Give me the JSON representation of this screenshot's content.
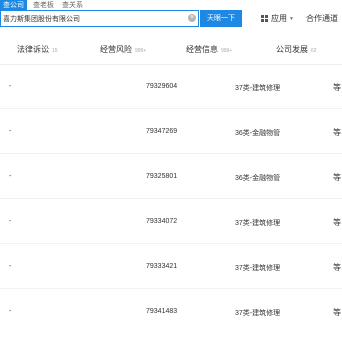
{
  "search_tabs": [
    "查公司",
    "查老板",
    "查关系"
  ],
  "search": {
    "value": "喜力斯集团股份有限公司",
    "button_label": "天眼一下"
  },
  "menus": {
    "apps_label": "应用",
    "coop_label": "合作通道"
  },
  "columns": [
    {
      "label": "法律诉讼",
      "count": "15"
    },
    {
      "label": "经营风险",
      "count": "999+"
    },
    {
      "label": "经营信息",
      "count": "999+"
    },
    {
      "label": "公司发展",
      "count": "62"
    }
  ],
  "rows": [
    {
      "marker": "-",
      "number": "79329604",
      "category": "37类-建筑修理",
      "more": "等"
    },
    {
      "marker": "-",
      "number": "79347269",
      "category": "36类-金融物管",
      "more": "等"
    },
    {
      "marker": "-",
      "number": "79325801",
      "category": "36类-金融物管",
      "more": "等"
    },
    {
      "marker": "-",
      "number": "79334072",
      "category": "37类-建筑修理",
      "more": "等"
    },
    {
      "marker": "-",
      "number": "79333421",
      "category": "37类-建筑修理",
      "more": "等"
    },
    {
      "marker": "-",
      "number": "79341483",
      "category": "37类-建筑修理",
      "more": "等"
    }
  ],
  "colors": {
    "accent": "#1e88e5"
  }
}
